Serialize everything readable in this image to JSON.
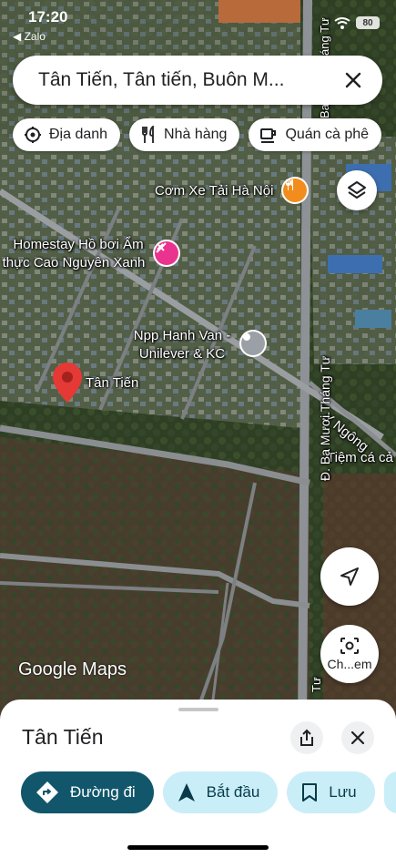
{
  "status_bar": {
    "time": "17:20",
    "back_app": "◀ Zalo",
    "battery": "80"
  },
  "search": {
    "query": "Tân Tiến, Tân tiến, Buôn M..."
  },
  "chips": [
    {
      "label": "Địa danh",
      "icon": "landmark-icon"
    },
    {
      "label": "Nhà hàng",
      "icon": "restaurant-icon"
    },
    {
      "label": "Quán cà phê",
      "icon": "coffee-icon"
    }
  ],
  "map": {
    "labels": {
      "com_xe_tai": "Cơm Xe Tải Hà Nội",
      "homestay_line1": "Homestay Hồ bơi Ẩm",
      "homestay_line2": "thực Cao Nguyên Xanh",
      "npp_line1": "Npp Hanh Van -",
      "npp_line2": "Unilever & KC",
      "tan_tien": "Tân Tiến",
      "y_ngong": "Y Ngông",
      "tiem_ca": "Tiệm cá cả",
      "ba_muoi_thang_tu": "Đ. Ba Mươi Tháng Tư",
      "top_road": "Ba Mươi Tháng Tư",
      "bottom_road": "Tư"
    },
    "accent_colors": {
      "food_pin": "#f28c1c",
      "hotel_pin": "#e9338f",
      "place_pin": "#e53935"
    }
  },
  "google_logo": "Google Maps",
  "lens_button": {
    "label": "Ch...em"
  },
  "sheet": {
    "title": "Tân Tiến",
    "actions": [
      {
        "label": "Đường đi",
        "icon": "directions-icon"
      },
      {
        "label": "Bắt đầu",
        "icon": "navigation-arrow-icon"
      },
      {
        "label": "Lưu",
        "icon": "bookmark-icon"
      }
    ]
  }
}
